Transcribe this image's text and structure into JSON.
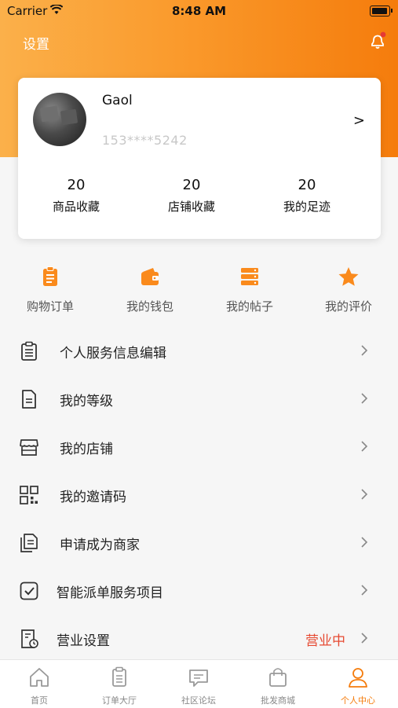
{
  "status_bar": {
    "carrier": "Carrier",
    "time": "8:48 AM"
  },
  "header": {
    "settings_label": "设置"
  },
  "profile": {
    "name": "Gaol",
    "phone": "153****5242",
    "arrow": ">",
    "stats": [
      {
        "value": "20",
        "label": "商品收藏"
      },
      {
        "value": "20",
        "label": "店铺收藏"
      },
      {
        "value": "20",
        "label": "我的足迹"
      }
    ]
  },
  "quick_actions": [
    {
      "label": "购物订单",
      "icon": "clipboard-icon"
    },
    {
      "label": "我的钱包",
      "icon": "wallet-icon"
    },
    {
      "label": "我的帖子",
      "icon": "stack-icon"
    },
    {
      "label": "我的评价",
      "icon": "star-icon"
    }
  ],
  "menu": [
    {
      "label": "个人服务信息编辑",
      "icon": "clipboard-outline-icon"
    },
    {
      "label": "我的等级",
      "icon": "document-icon"
    },
    {
      "label": "我的店铺",
      "icon": "store-icon"
    },
    {
      "label": "我的邀请码",
      "icon": "qr-code-icon"
    },
    {
      "label": "申请成为商家",
      "icon": "documents-icon"
    },
    {
      "label": "智能派单服务项目",
      "icon": "checkbox-icon"
    },
    {
      "label": "营业设置",
      "icon": "business-settings-icon",
      "status": "营业中"
    }
  ],
  "tabs": [
    {
      "label": "首页",
      "icon": "home-icon",
      "active": false
    },
    {
      "label": "订单大厅",
      "icon": "order-icon",
      "active": false
    },
    {
      "label": "社区论坛",
      "icon": "chat-icon",
      "active": false
    },
    {
      "label": "批发商城",
      "icon": "bag-icon",
      "active": false
    },
    {
      "label": "个人中心",
      "icon": "person-icon",
      "active": true
    }
  ],
  "colors": {
    "accent": "#f57c0c",
    "status_red": "#e64a32",
    "notification_dot": "#e53935"
  }
}
